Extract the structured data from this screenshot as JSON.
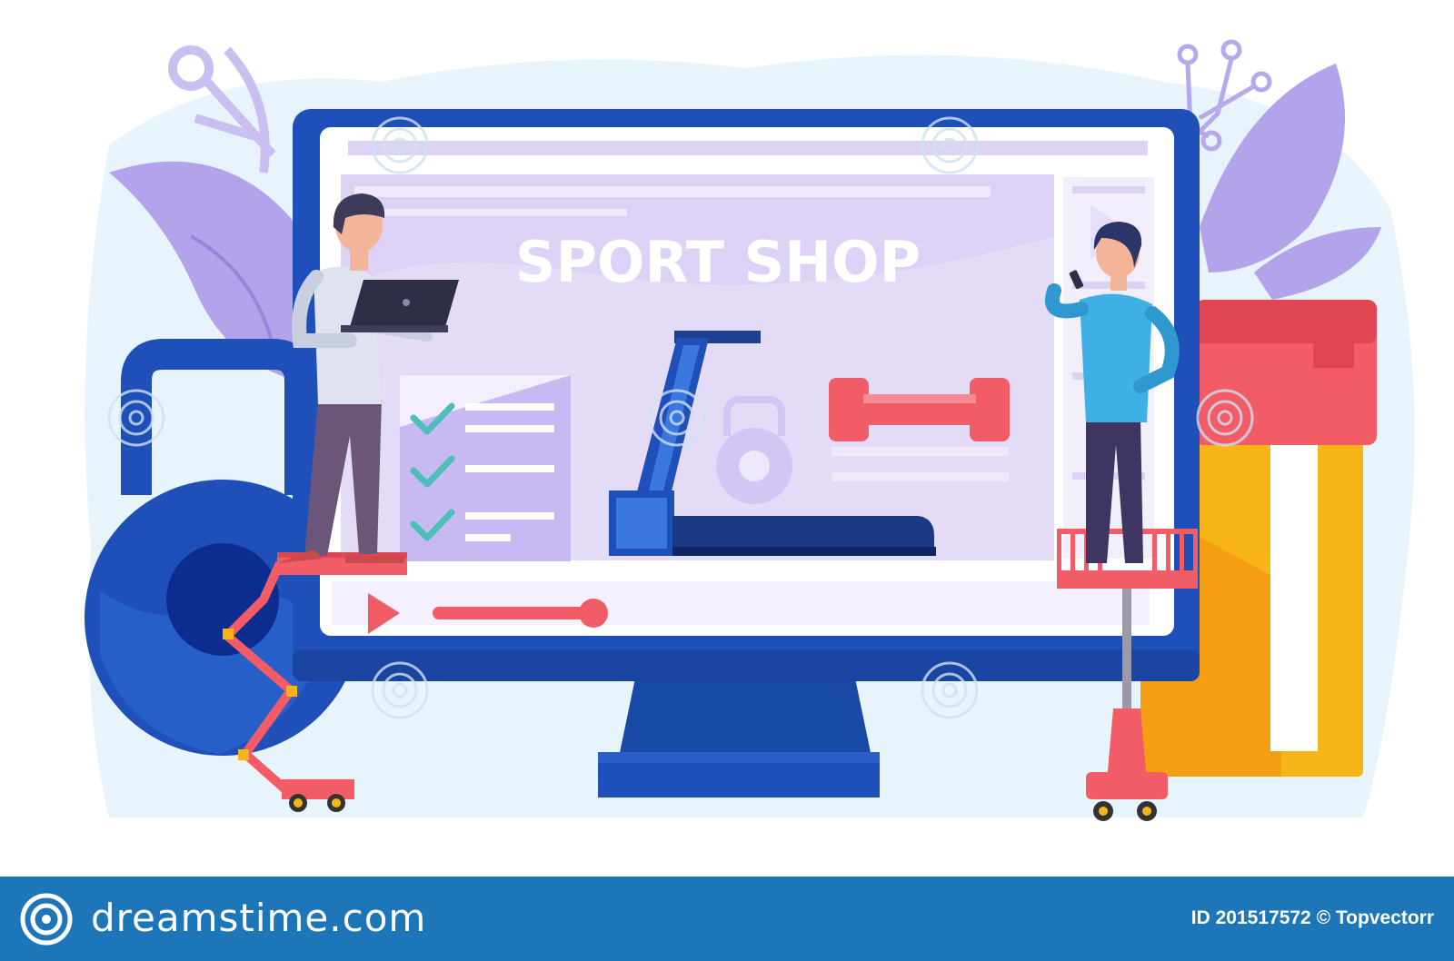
{
  "screen": {
    "title": "SPORT SHOP"
  },
  "footer": {
    "brand": "dreamstime.com",
    "credit": "ID 201517572 © Topvectorr"
  },
  "colors": {
    "monitor_blue": "#1f4fb8",
    "screen_lavender": "#e4dcf7",
    "accent_red": "#f25c66",
    "bottle_yellow": "#f7b417",
    "check_teal": "#4bbfb8",
    "leaf_purple": "#b3a3ea",
    "footer_blue": "#1c76b8"
  },
  "icons": [
    "play-icon",
    "check-icon",
    "dumbbell-icon",
    "kettlebell-icon",
    "treadmill-icon",
    "laptop-icon",
    "phone-icon",
    "dreamstime-logo-icon"
  ]
}
